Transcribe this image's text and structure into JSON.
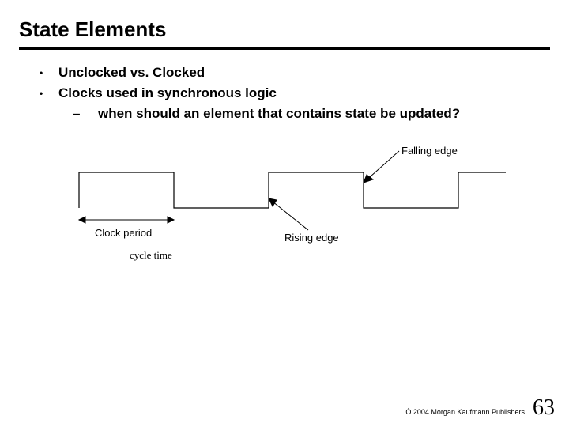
{
  "title": "State Elements",
  "bullets": [
    {
      "text": "Unclocked vs. Clocked"
    },
    {
      "text": "Clocks used in synchronous logic",
      "sub": [
        "when should an element that contains state be updated?"
      ]
    }
  ],
  "diagram": {
    "falling_edge": "Falling edge",
    "rising_edge": "Rising edge",
    "clock_period": "Clock period",
    "cycle_time": "cycle time"
  },
  "footer": {
    "copyright": "Ó 2004 Morgan Kaufmann Publishers",
    "page": "63"
  }
}
